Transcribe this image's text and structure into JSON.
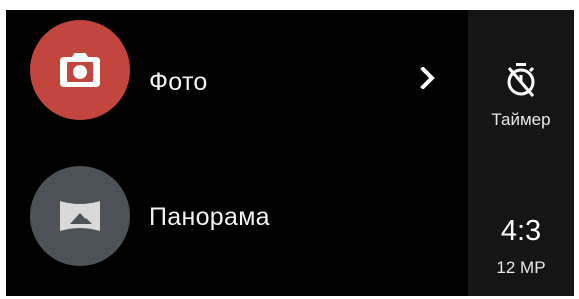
{
  "modes": [
    {
      "label": "Фото",
      "icon": "camera-icon",
      "color": "#c2453e",
      "has_chevron": true
    },
    {
      "label": "Панорама",
      "icon": "panorama-icon",
      "color": "#4d5258",
      "has_chevron": false
    }
  ],
  "side_panel": {
    "timer": {
      "icon": "timer-off-icon",
      "label": "Таймер"
    },
    "aspect_ratio": {
      "value": "4:3",
      "resolution": "12 MP"
    }
  },
  "colors": {
    "background": "#000000",
    "side_panel": "#151515",
    "photo_accent": "#c2453e",
    "panorama_accent": "#4d5258",
    "text": "#f2f2f2"
  }
}
